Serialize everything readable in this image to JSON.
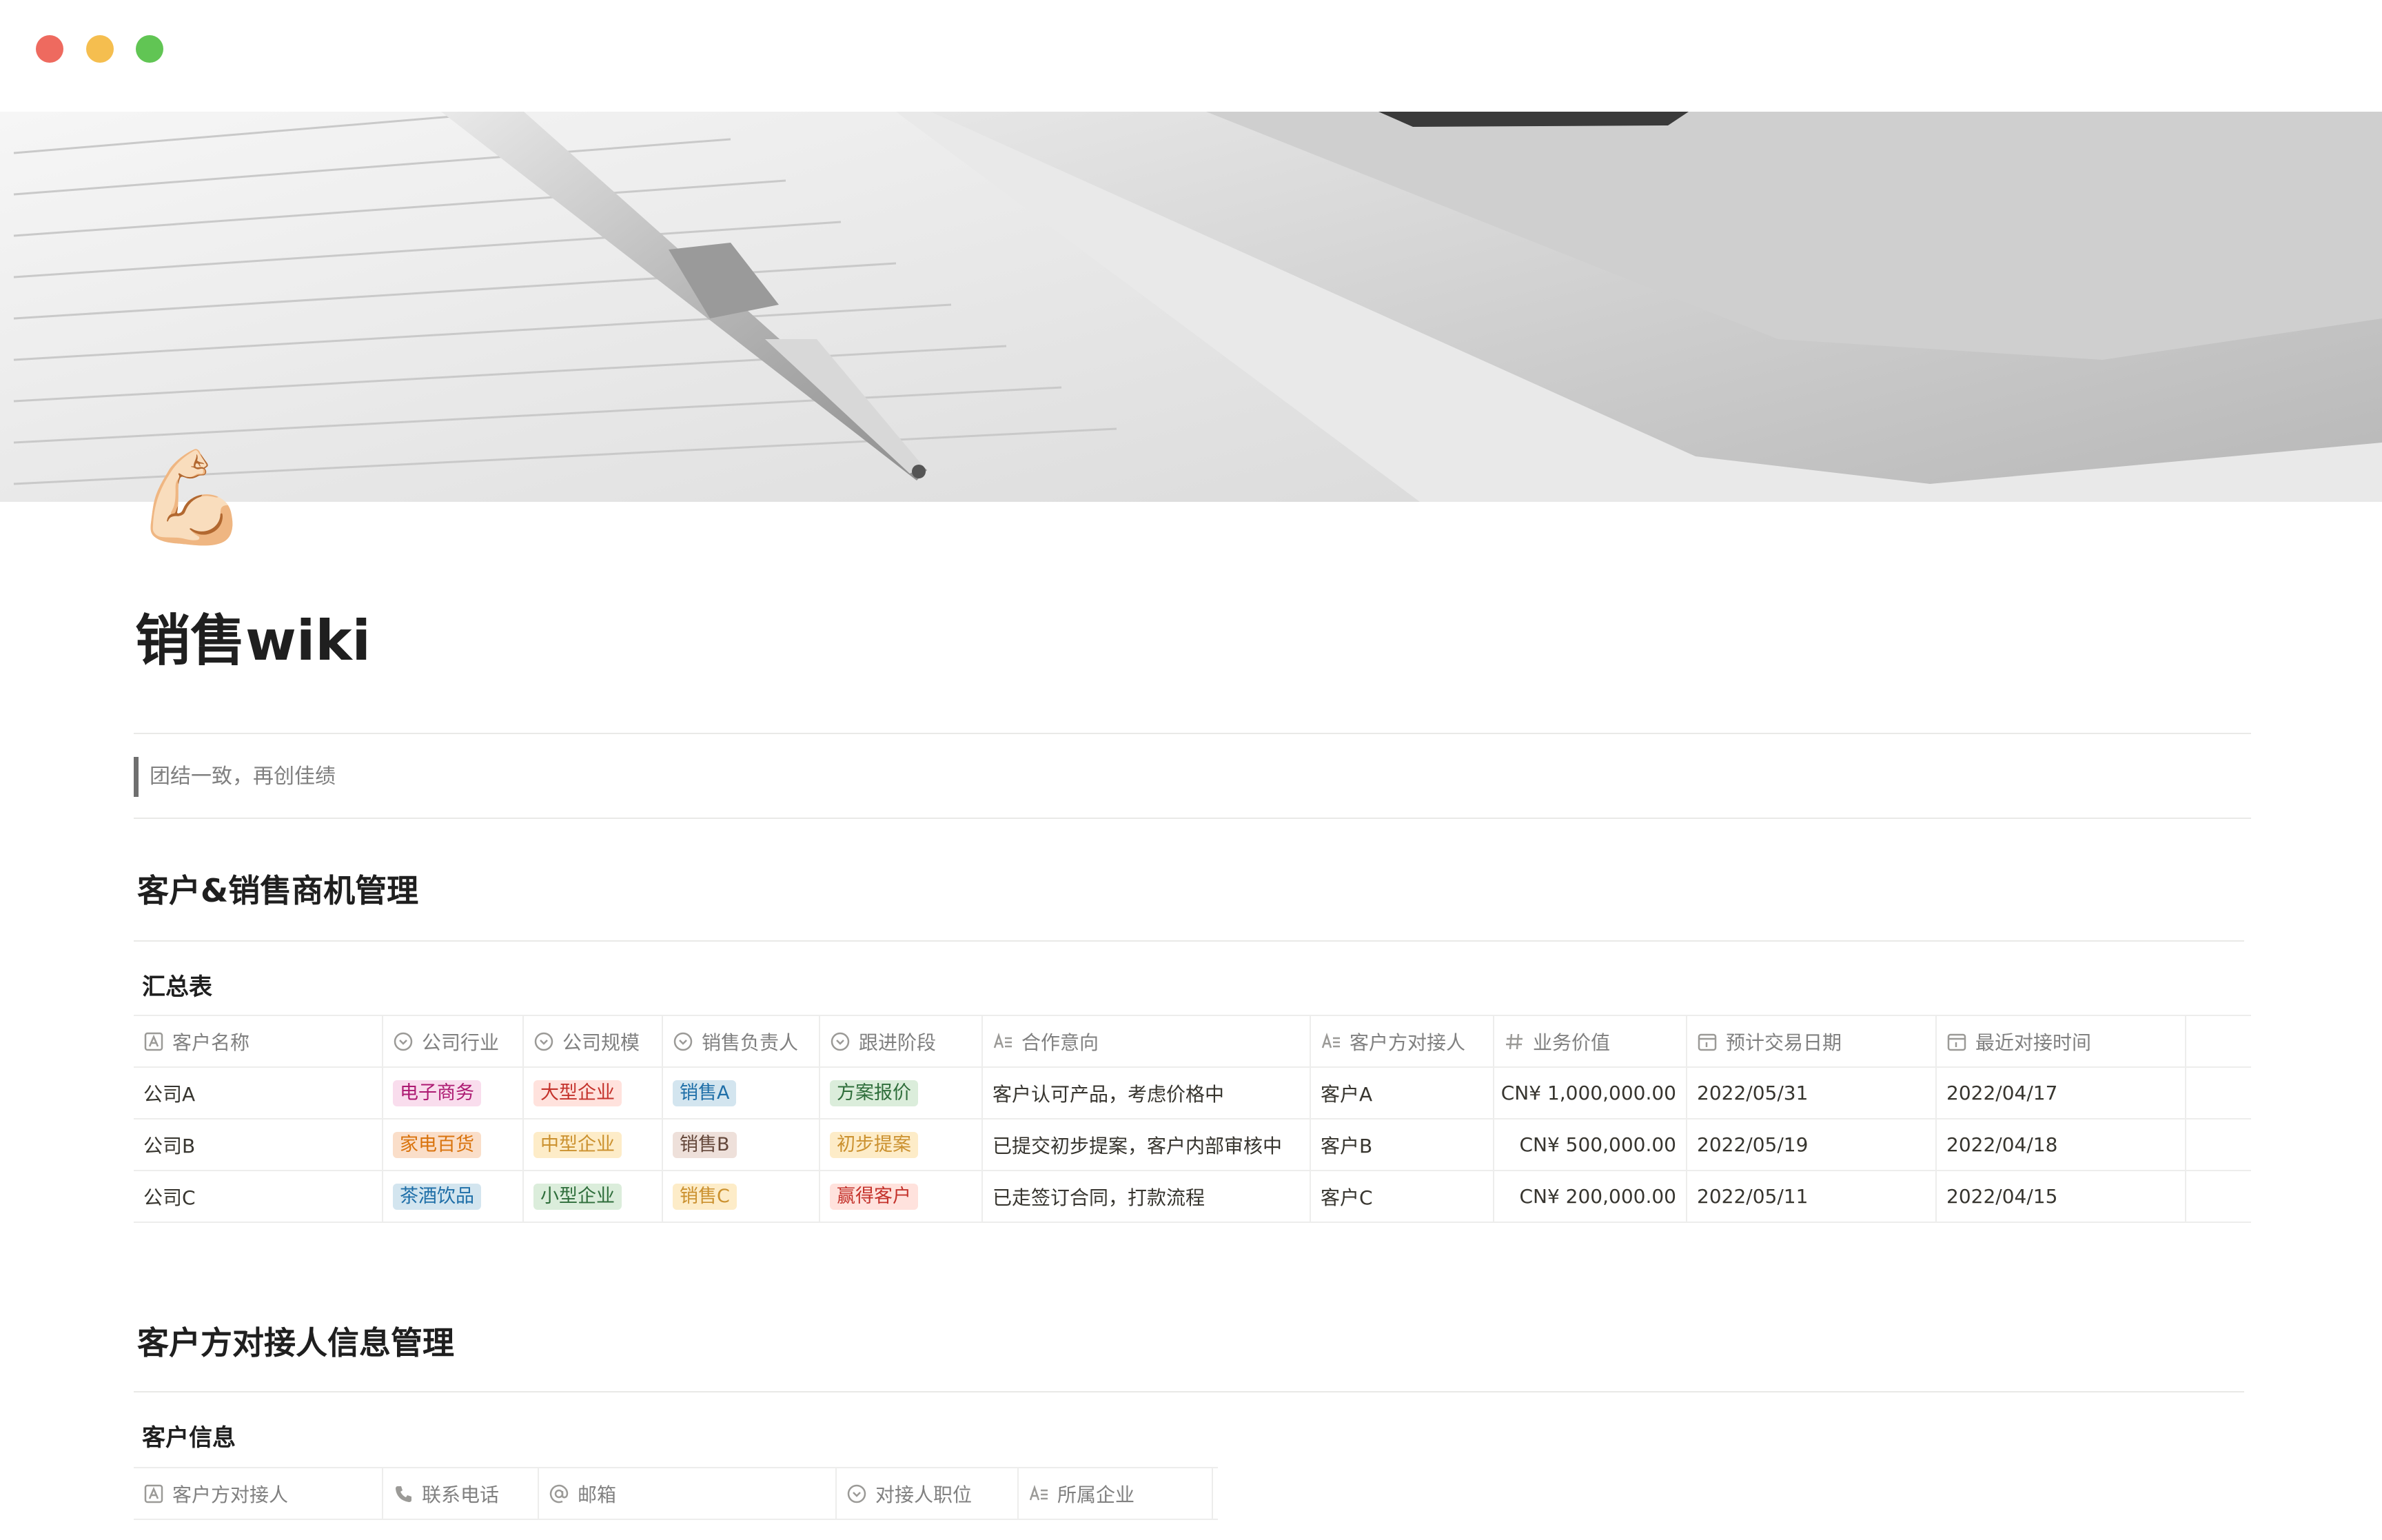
{
  "window": {
    "controls": [
      "close",
      "minimize",
      "zoom"
    ]
  },
  "page": {
    "icon": "💪🏻",
    "title": "销售wiki",
    "quote": "团结一致，再创佳绩"
  },
  "section1": {
    "heading": "客户&销售商机管理",
    "db_title": "汇总表",
    "columns": [
      {
        "label": "客户名称",
        "icon": "title-icon"
      },
      {
        "label": "公司行业",
        "icon": "select-icon"
      },
      {
        "label": "公司规模",
        "icon": "select-icon"
      },
      {
        "label": "销售负责人",
        "icon": "select-icon"
      },
      {
        "label": "跟进阶段",
        "icon": "select-icon"
      },
      {
        "label": "合作意向",
        "icon": "text-icon"
      },
      {
        "label": "客户方对接人",
        "icon": "text-icon"
      },
      {
        "label": "业务价值",
        "icon": "number-icon"
      },
      {
        "label": "预计交易日期",
        "icon": "date-icon"
      },
      {
        "label": "最近对接时间",
        "icon": "date-icon"
      }
    ],
    "rows": [
      {
        "name": "公司A",
        "industry": {
          "text": "电子商务",
          "color": "pink"
        },
        "size": {
          "text": "大型企业",
          "color": "red"
        },
        "owner": {
          "text": "销售A",
          "color": "blue"
        },
        "stage": {
          "text": "方案报价",
          "color": "green"
        },
        "intent": "客户认可产品，考虑价格中",
        "contact": "客户A",
        "value": "CN¥ 1,000,000.00",
        "expected_date": "2022/05/31",
        "last_contact": "2022/04/17"
      },
      {
        "name": "公司B",
        "industry": {
          "text": "家电百货",
          "color": "orange"
        },
        "size": {
          "text": "中型企业",
          "color": "yellow"
        },
        "owner": {
          "text": "销售B",
          "color": "brown"
        },
        "stage": {
          "text": "初步提案",
          "color": "yellow"
        },
        "intent": "已提交初步提案，客户内部审核中",
        "contact": "客户B",
        "value": "CN¥ 500,000.00",
        "expected_date": "2022/05/19",
        "last_contact": "2022/04/18"
      },
      {
        "name": "公司C",
        "industry": {
          "text": "茶酒饮品",
          "color": "blue"
        },
        "size": {
          "text": "小型企业",
          "color": "green"
        },
        "owner": {
          "text": "销售C",
          "color": "yellow"
        },
        "stage": {
          "text": "赢得客户",
          "color": "red"
        },
        "intent": "已走签订合同，打款流程",
        "contact": "客户C",
        "value": "CN¥ 200,000.00",
        "expected_date": "2022/05/11",
        "last_contact": "2022/04/15"
      }
    ]
  },
  "section2": {
    "heading": "客户方对接人信息管理",
    "db_title": "客户信息",
    "columns": [
      {
        "label": "客户方对接人",
        "icon": "title-icon"
      },
      {
        "label": "联系电话",
        "icon": "phone-icon"
      },
      {
        "label": "邮箱",
        "icon": "at-icon"
      },
      {
        "label": "对接人职位",
        "icon": "select-icon"
      },
      {
        "label": "所属企业",
        "icon": "text-icon"
      }
    ]
  },
  "tag_colors": {
    "pink": {
      "bg": "#f9dded",
      "fg": "#ad1a72"
    },
    "red": {
      "bg": "#ffe2dd",
      "fg": "#c4332c"
    },
    "blue": {
      "bg": "#d3e5ef",
      "fg": "#1f6fa8"
    },
    "green": {
      "bg": "#dbeddb",
      "fg": "#2f6e3b"
    },
    "orange": {
      "bg": "#fadec9",
      "fg": "#d9730d"
    },
    "yellow": {
      "bg": "#fdecc8",
      "fg": "#cb912f"
    },
    "brown": {
      "bg": "#eee0da",
      "fg": "#64473a"
    }
  }
}
